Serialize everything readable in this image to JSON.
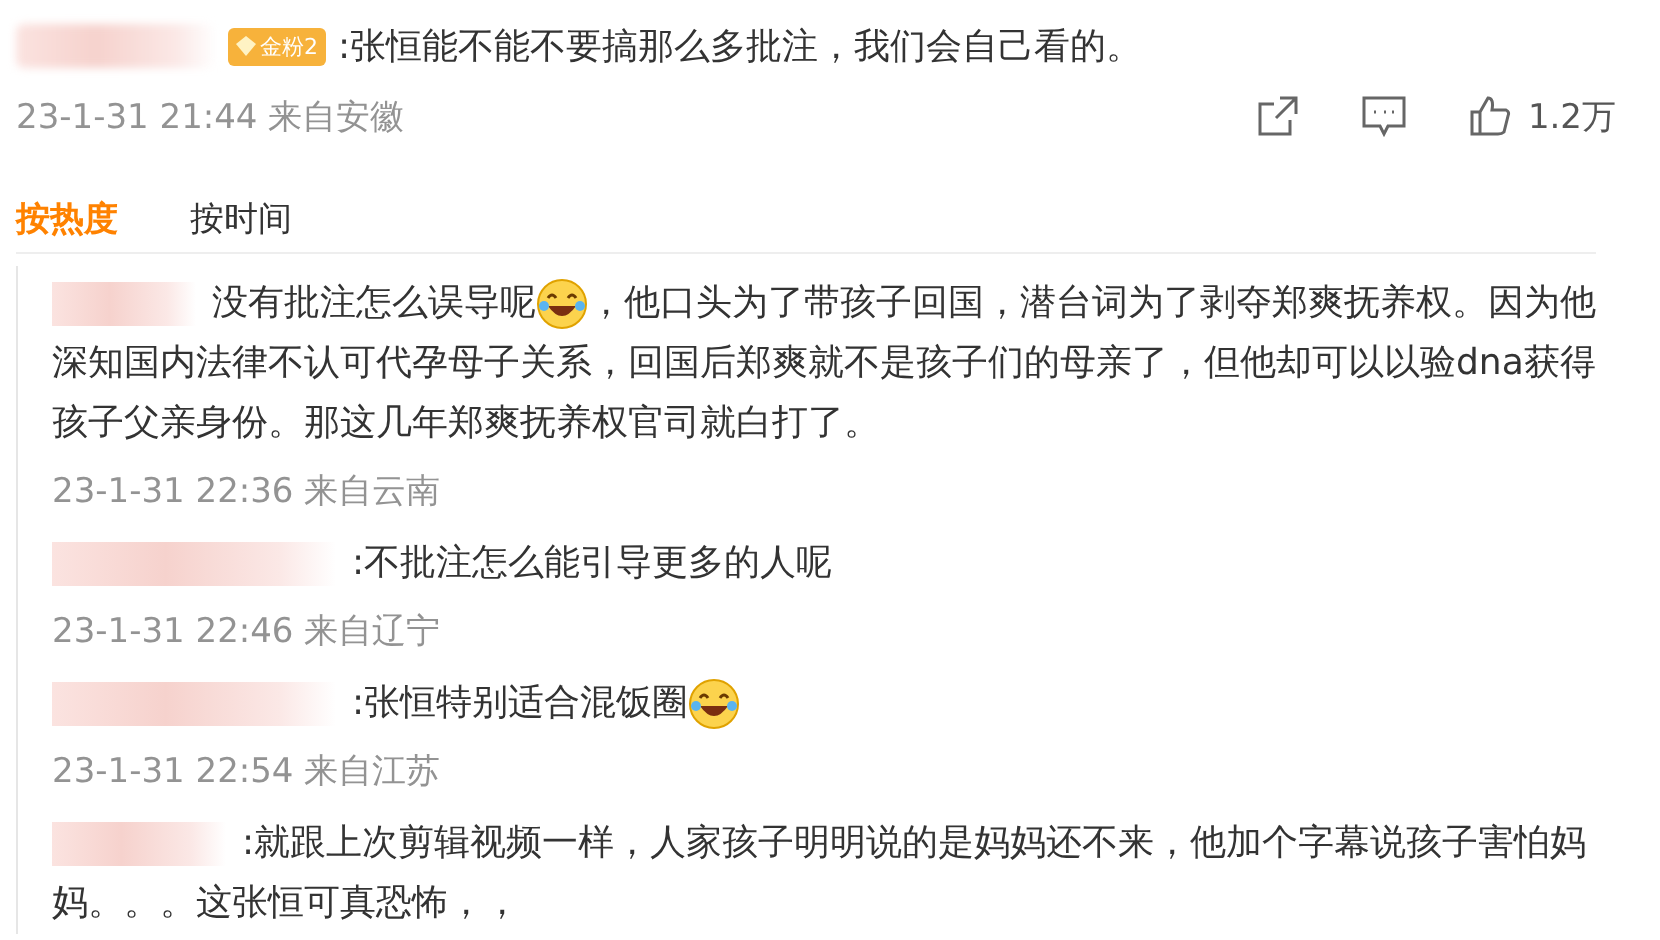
{
  "comment": {
    "badge": "金粉2",
    "text": ":张恒能不能不要搞那么多批注，我们会自己看的。",
    "meta": "23-1-31 21:44 来自安徽",
    "likes": "1.2万"
  },
  "sort_tabs": [
    {
      "label": "按热度",
      "selected": true
    },
    {
      "label": "按时间",
      "selected": false
    }
  ],
  "replies": [
    {
      "parts": [
        {
          "kind": "text",
          "text": "没有批注怎么误导呢"
        },
        {
          "kind": "emoji"
        },
        {
          "kind": "text",
          "text": "，他口头为了带孩子回国，潜台词为了剥夺郑爽抚养权。因为他深知国内法律不认可代孕母子关系，回国后郑爽就不是孩子们的母亲了，但他却可以以验dna获得孩子父亲身份。那这几年郑爽抚养权官司就白打了。"
        }
      ],
      "meta": "23-1-31 22:36 来自云南"
    },
    {
      "parts": [
        {
          "kind": "text",
          "text": ":不批注怎么能引导更多的人呢"
        }
      ],
      "meta": "23-1-31 22:46 来自辽宁"
    },
    {
      "parts": [
        {
          "kind": "text",
          "text": ":张恒特别适合混饭圈"
        },
        {
          "kind": "emoji"
        }
      ],
      "meta": "23-1-31 22:54 来自江苏"
    },
    {
      "parts": [
        {
          "kind": "text",
          "text": ":就跟上次剪辑视频一样，人家孩子明明说的是妈妈还不来，他加个字幕说孩子害怕妈妈。。。这张恒可真恐怖，，"
        }
      ]
    }
  ]
}
